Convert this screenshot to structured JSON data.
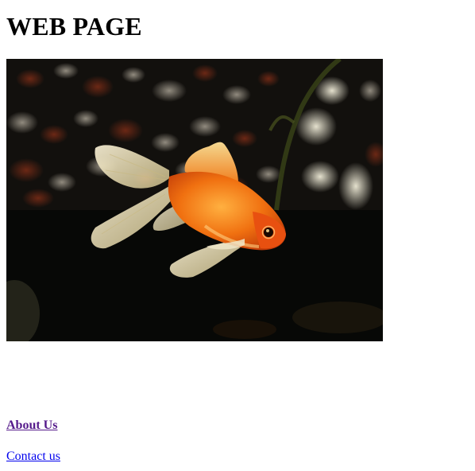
{
  "header": {
    "title": "WEB PAGE"
  },
  "hero_image": {
    "subject": "goldfish-photo",
    "colors": {
      "background": "#070806",
      "fish_body": "#f06a0e",
      "fish_fins": "#e8d8b0"
    }
  },
  "links": {
    "about_label": "About Us",
    "contact_label": "Contact us",
    "visited_color": "#551a8b",
    "link_color": "#0000ee"
  }
}
